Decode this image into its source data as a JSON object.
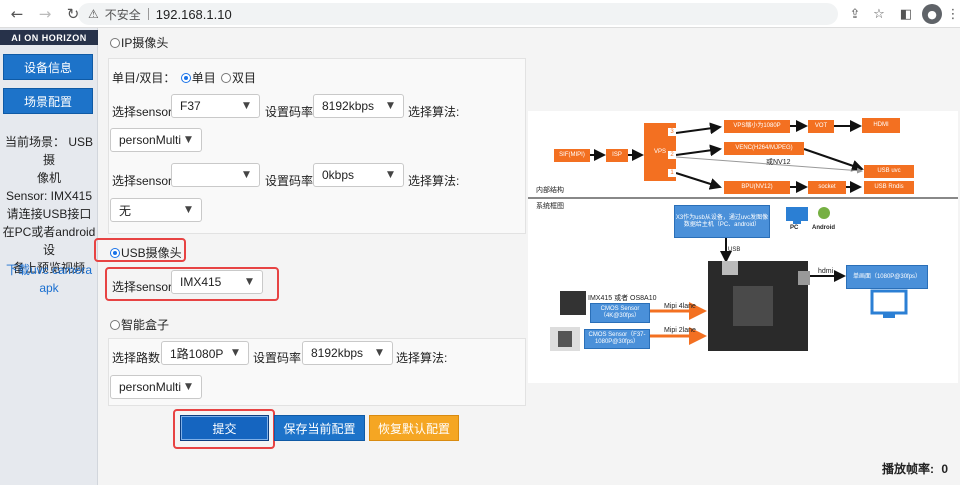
{
  "browser": {
    "insecure_label": "不安全",
    "url": "192.168.1.10"
  },
  "sidebar": {
    "logo_text": "AI ON HORIZON",
    "device_info_label": "设备信息",
    "scene_config_label": "场景配置",
    "current_scene_lines": [
      "当前场景： USB摄",
      "像机",
      "Sensor: IMX415",
      "请连接USB接口",
      "在PC或者android设",
      "备上预览视频"
    ],
    "download_lines": [
      "下载uvc camera",
      "apk"
    ]
  },
  "ip_camera": {
    "label": "IP摄像头",
    "mode_label": "单目/双目：",
    "mode_single": "单目",
    "mode_dual": "双目",
    "sensor_label": "选择sensor:",
    "bitrate_label": "设置码率:",
    "algo_label": "选择算法:",
    "row1": {
      "sensor": "F37",
      "bitrate": "8192kbps",
      "algo": "personMulti"
    },
    "row2": {
      "sensor": "",
      "bitrate": "0kbps",
      "algo": "无"
    }
  },
  "usb_camera": {
    "label": "USB摄像头",
    "sensor_label": "选择sensor:",
    "sensor": "IMX415"
  },
  "smart_box": {
    "label": "智能盒子",
    "channels_label": "选择路数:",
    "channels": "1路1080P",
    "bitrate_label": "设置码率:",
    "bitrate": "8192kbps",
    "algo_label": "选择算法:",
    "algo": "personMulti"
  },
  "actions": {
    "submit": "提交",
    "save": "保存当前配置",
    "restore": "恢复默认配置"
  },
  "diagram": {
    "inner_label": "内部结构",
    "system_label": "系统框图",
    "sif": "SIF(MIPI)",
    "isp": "ISP",
    "vps": "VPS",
    "port_3": "3",
    "port_2": "2",
    "port_1": "1",
    "vps_scale": "VPS缩小为1080P",
    "vot": "VOT",
    "hdmi": "HDMI",
    "venc": "VENC(H264/MJPEG)",
    "nv12_or": "或NV12",
    "usb_uvc": "USB uvc",
    "bpu": "BPU(NV12)",
    "socket": "socket",
    "usb_rndis": "USB Rndis",
    "x3_desc": "X3作为usb从设备，通过uvc发图像数据给主机（PC、android）",
    "pc": "PC",
    "android": "Android",
    "usb": "USB",
    "hdmi_small": "hdmi",
    "display_desc": "单画面（1080P@30fps）",
    "sensor_names": "IMX415 或者 OS8A10",
    "cmos1": "CMOS Sensor（4K@30fps）",
    "mipi4": "Mipi 4lane",
    "cmos2": "CMOS Sensor（F37-1080P@30fps）",
    "mipi2": "Mipi 2lane"
  },
  "footer": {
    "rate_label": "播放帧率:",
    "rate_value": "0"
  }
}
